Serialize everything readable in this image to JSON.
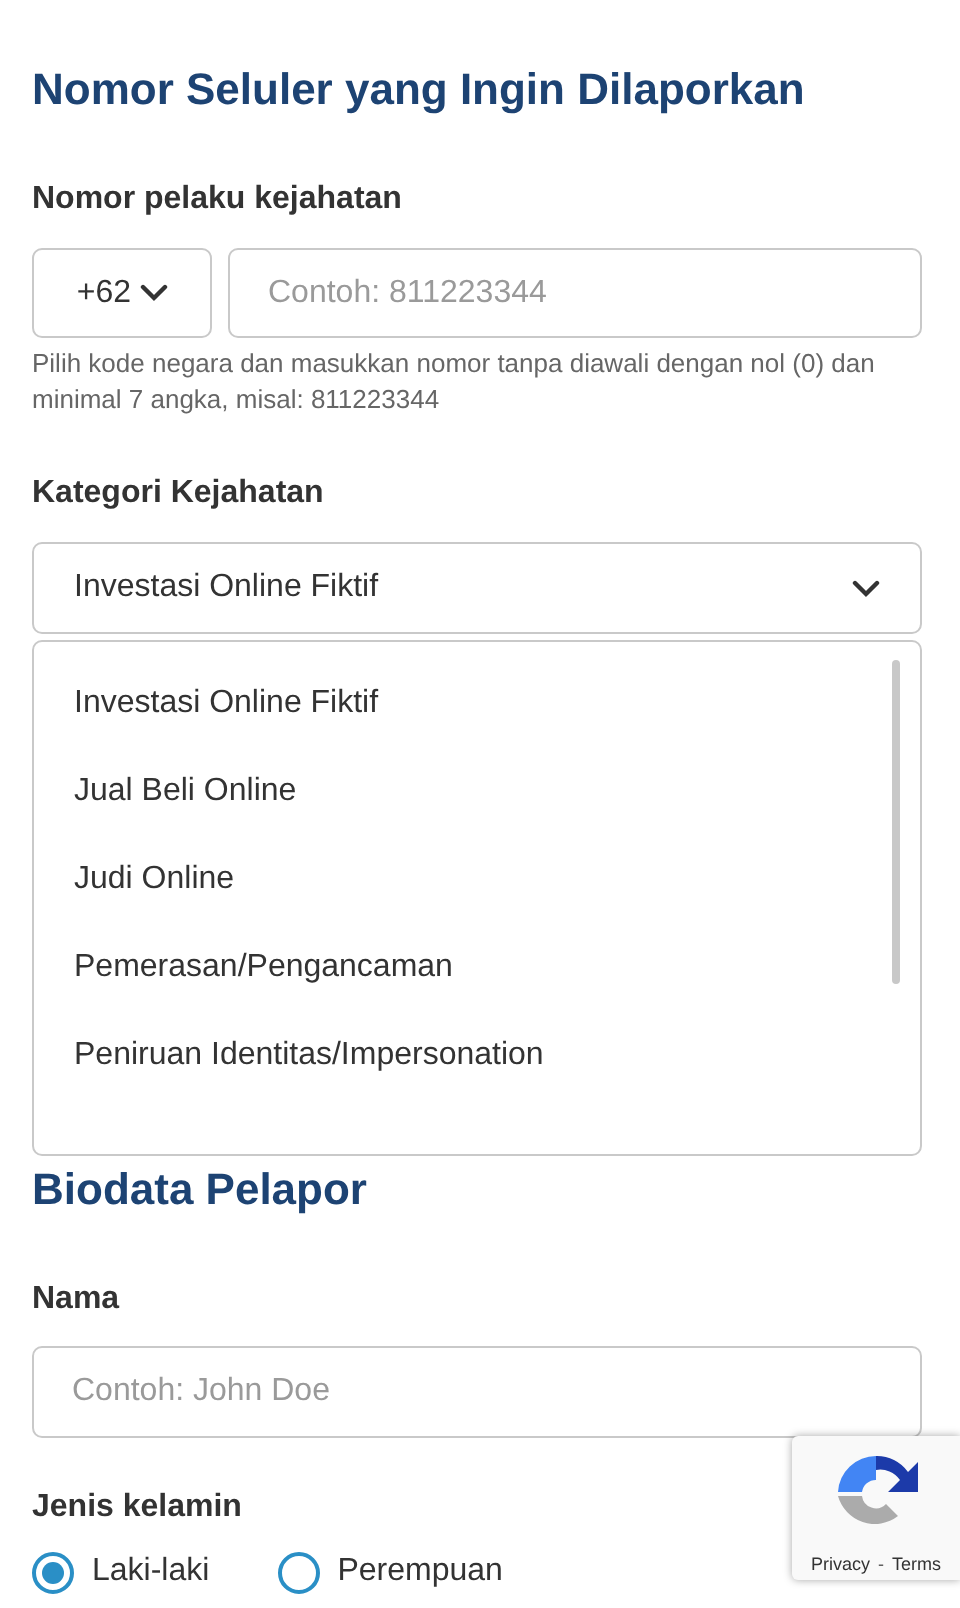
{
  "sections": [
    {
      "title": "Nomor Seluler yang Ingin Dilaporkan"
    },
    {
      "title": "Biodata Pelapor"
    }
  ],
  "phone": {
    "label": "Nomor pelaku kejahatan",
    "country_code": "+62",
    "placeholder": "Contoh: 811223344",
    "help": "Pilih kode negara dan masukkan nomor tanpa diawali dengan nol (0) dan minimal 7 angka, misal: 811223344"
  },
  "category": {
    "label": "Kategori Kejahatan",
    "value": "Investasi Online Fiktif",
    "expanded": true,
    "options": [
      {
        "label": "Investasi Online Fiktif"
      },
      {
        "label": "Jual Beli Online"
      },
      {
        "label": "Judi Online"
      },
      {
        "label": "Pemerasan/Pengancaman"
      },
      {
        "label": "Peniruan Identitas/Impersonation"
      }
    ]
  },
  "name": {
    "label": "Nama",
    "placeholder": "Contoh: John Doe"
  },
  "gender": {
    "label": "Jenis kelamin",
    "options": [
      {
        "label": "Laki-laki",
        "selected": true
      },
      {
        "label": "Perempuan",
        "selected": false
      }
    ]
  },
  "recaptcha": {
    "links": [
      "Privacy",
      "Terms"
    ],
    "separator": "-"
  }
}
